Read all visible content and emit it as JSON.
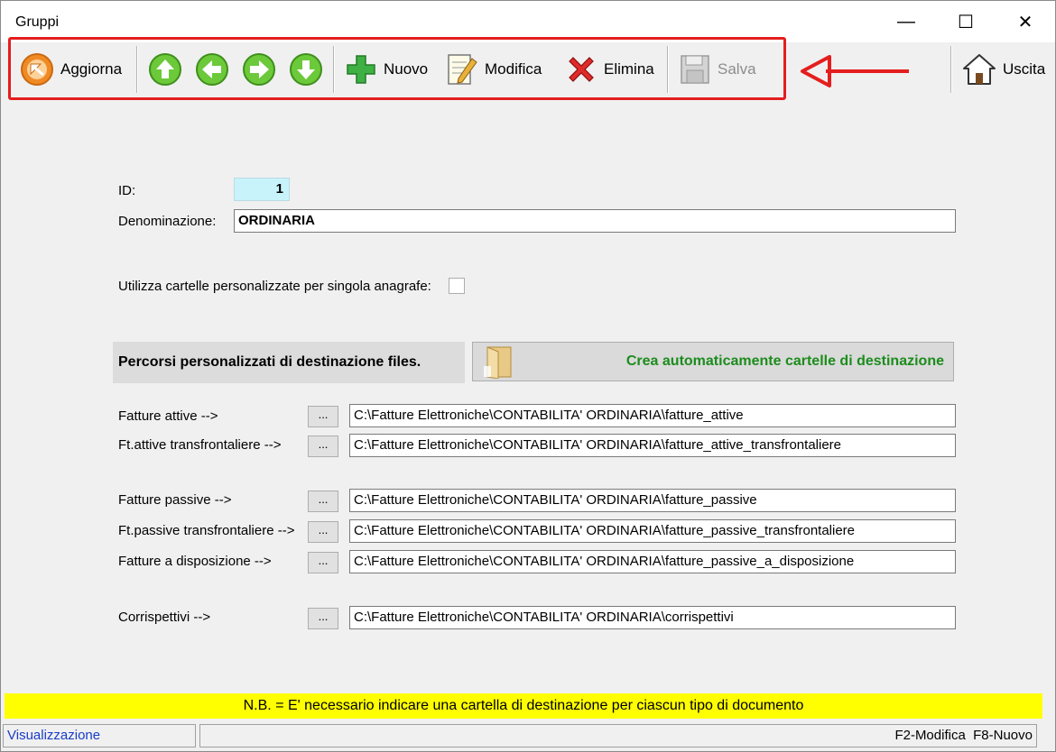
{
  "window": {
    "title": "Gruppi",
    "minimize": "—",
    "maximize": "☐",
    "close": "✕"
  },
  "toolbar": {
    "aggiorna": "Aggiorna",
    "nuovo": "Nuovo",
    "modifica": "Modifica",
    "elimina": "Elimina",
    "salva": "Salva",
    "uscita": "Uscita"
  },
  "form": {
    "id_label": "ID:",
    "id_value": "1",
    "denominazione_label": "Denominazione:",
    "denominazione_value": "ORDINARIA",
    "cartelle_label": "Utilizza cartelle personalizzate per singola anagrafe:",
    "cartelle_checked": false
  },
  "percorsi": {
    "heading": "Percorsi personalizzati di destinazione files.",
    "crea_button": "Crea automaticamente cartelle di destinazione",
    "browse_label": "...",
    "rows": [
      {
        "label": "Fatture attive -->",
        "path": "C:\\Fatture Elettroniche\\CONTABILITA' ORDINARIA\\fatture_attive"
      },
      {
        "label": "Ft.attive transfrontaliere -->",
        "path": "C:\\Fatture Elettroniche\\CONTABILITA' ORDINARIA\\fatture_attive_transfrontaliere"
      },
      {
        "label": "Fatture passive -->",
        "path": "C:\\Fatture Elettroniche\\CONTABILITA' ORDINARIA\\fatture_passive"
      },
      {
        "label": "Ft.passive transfrontaliere -->",
        "path": "C:\\Fatture Elettroniche\\CONTABILITA' ORDINARIA\\fatture_passive_transfrontaliere"
      },
      {
        "label": "Fatture a disposizione -->",
        "path": "C:\\Fatture Elettroniche\\CONTABILITA' ORDINARIA\\fatture_passive_a_disposizione"
      },
      {
        "label": "Corrispettivi -->",
        "path": "C:\\Fatture Elettroniche\\CONTABILITA' ORDINARIA\\corrispettivi"
      }
    ]
  },
  "note": "N.B. = E' necessario indicare una cartella di destinazione per ciascun tipo di documento",
  "statusbar": {
    "mode": "Visualizzazione",
    "shortcuts": "F2-Modifica  F8-Nuovo"
  },
  "colors": {
    "highlight_box": "#e41e1e",
    "note_background": "#ffff00",
    "crea_text": "#1c8c1c",
    "id_field": "#c9f3fb",
    "status_mode_text": "#1a3cc8"
  }
}
